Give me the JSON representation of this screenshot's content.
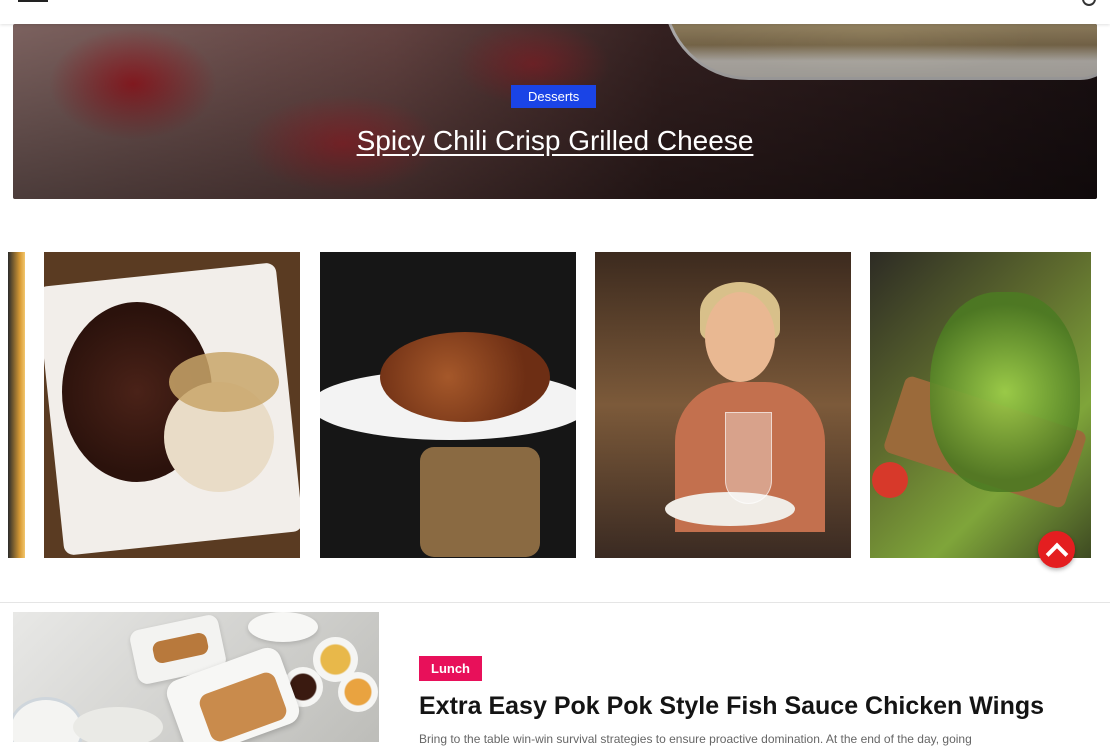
{
  "hero": {
    "category": "Desserts",
    "title": "Spicy Chili Crisp Grilled Cheese"
  },
  "carousel": {
    "items": [
      "card-0",
      "card-1",
      "card-2",
      "card-3",
      "card-4"
    ]
  },
  "back_to_top": {
    "icon": "chevron-up-icon",
    "color": "#e41e20"
  },
  "post": {
    "category": "Lunch",
    "category_color": "#e8105a",
    "title": "Extra Easy Pok Pok Style Fish Sauce Chicken Wings",
    "excerpt": "Bring to the table win-win survival strategies to ensure proactive domination. At the end of the day, going"
  },
  "colors": {
    "hero_category": "#1a44e6"
  }
}
